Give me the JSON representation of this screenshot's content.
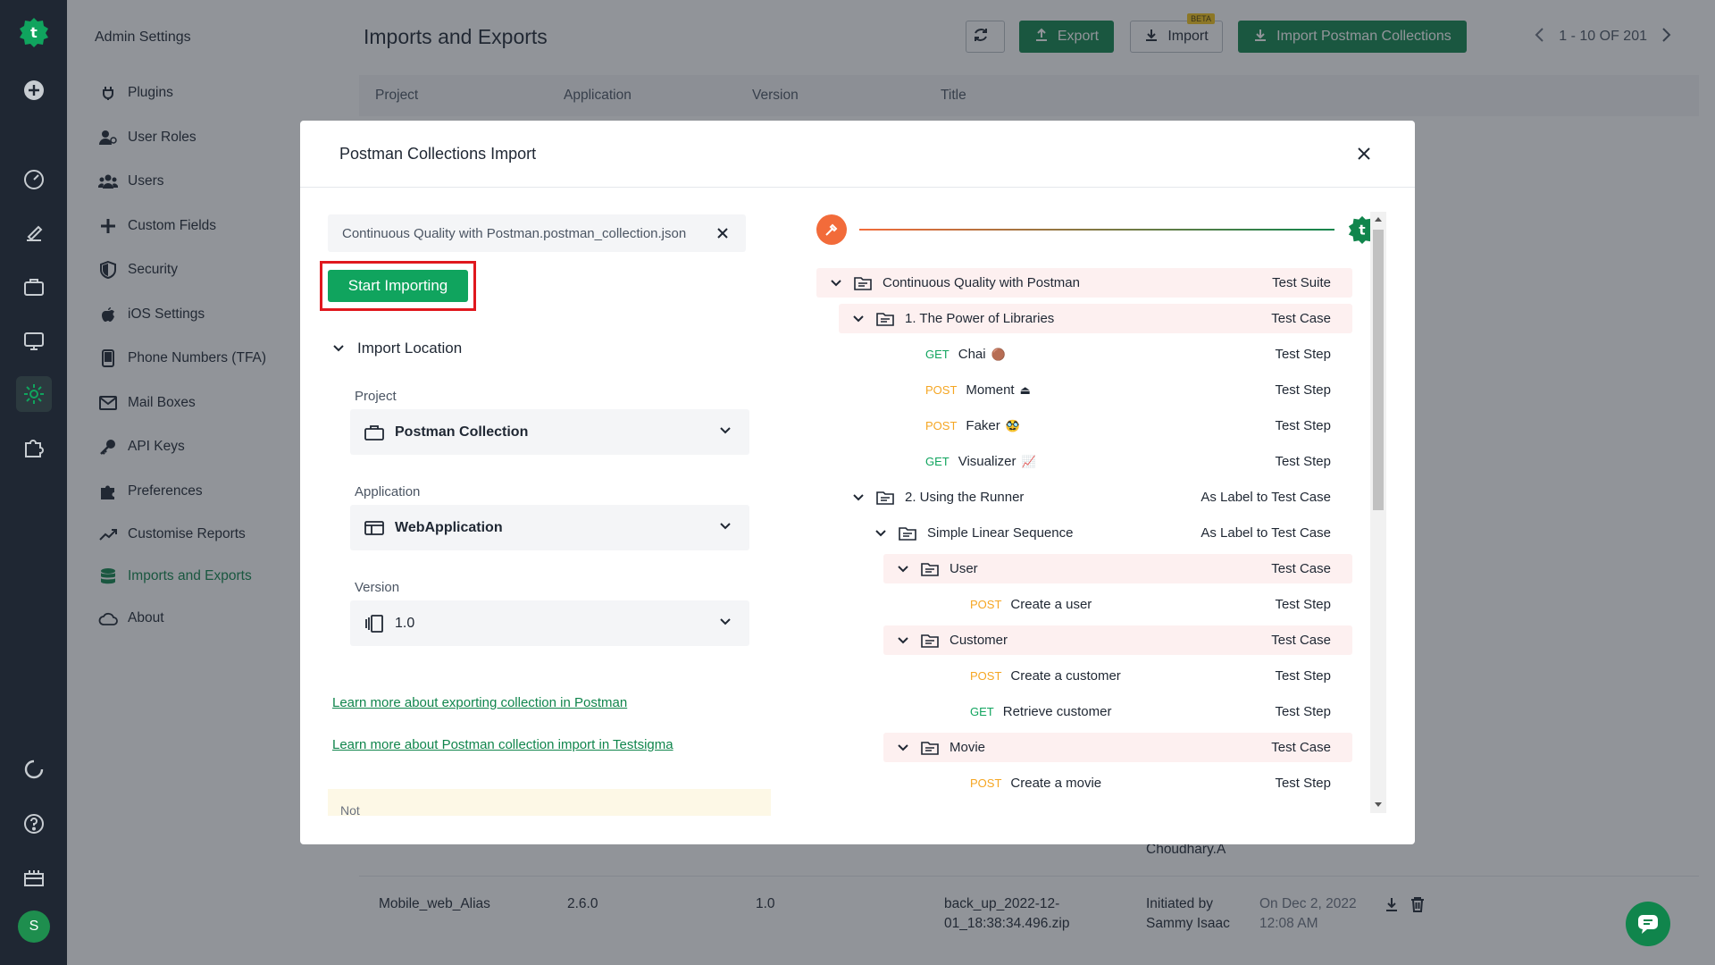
{
  "sidebar": {
    "title": "Admin Settings",
    "items": [
      {
        "label": "Plugins",
        "icon": "plug-icon"
      },
      {
        "label": "User Roles",
        "icon": "user-roles-icon"
      },
      {
        "label": "Users",
        "icon": "users-icon"
      },
      {
        "label": "Custom Fields",
        "icon": "plus-icon"
      },
      {
        "label": "Security",
        "icon": "shield-icon"
      },
      {
        "label": "iOS Settings",
        "icon": "apple-icon"
      },
      {
        "label": "Phone Numbers (TFA)",
        "icon": "phone-icon"
      },
      {
        "label": "Mail Boxes",
        "icon": "mail-icon"
      },
      {
        "label": "API Keys",
        "icon": "key-icon"
      },
      {
        "label": "Preferences",
        "icon": "puzzle-icon"
      },
      {
        "label": "Customise Reports",
        "icon": "chart-line-icon"
      },
      {
        "label": "Imports and Exports",
        "icon": "database-icon",
        "active": true
      },
      {
        "label": "About",
        "icon": "cloud-icon"
      }
    ]
  },
  "rail": {
    "avatar_letter": "S"
  },
  "header": {
    "title": "Imports and Exports",
    "export_label": "Export",
    "import_label": "Import",
    "beta_badge": "BETA",
    "import_postman_label": "Import Postman Collections",
    "pager_text": "1 - 10  OF 201"
  },
  "table": {
    "columns": [
      "Project",
      "Application",
      "Version",
      "Title"
    ],
    "visible_row": {
      "project": "Mobile_web_Alias",
      "application": "2.6.0",
      "version": "1.0",
      "title_line1": "back_up_2022-12-",
      "title_line2": "01_18:38:34.496.zip",
      "initiated_line1": "Initiated by",
      "initiated_line2": "Sammy Isaac",
      "date_line1": "On Dec 2, 2022",
      "date_line2": "12:08 AM"
    },
    "partial_text": "Choudhary.A"
  },
  "modal": {
    "title": "Postman Collections Import",
    "file_name": "Continuous Quality with Postman.postman_collection.json",
    "start_button": "Start Importing",
    "location_title": "Import Location",
    "project_label": "Project",
    "project_value": "Postman Collection",
    "application_label": "Application",
    "application_value": "WebApplication",
    "version_label": "Version",
    "version_value": "1.0",
    "link1": "Learn more about exporting collection in Postman",
    "link2": "Learn more about Postman collection import in Testsigma",
    "note_partial": "Not"
  },
  "tree": [
    {
      "label": "Continuous Quality with Postman",
      "tag": "Test Suite",
      "level": 0,
      "type": "folder",
      "pink": true
    },
    {
      "label": "1. The Power of Libraries",
      "tag": "Test Case",
      "level": 1,
      "type": "folder",
      "pink": true
    },
    {
      "label": "Chai",
      "emoji": "🟤",
      "method": "GET",
      "tag": "Test Step",
      "level": 2,
      "type": "request"
    },
    {
      "label": "Moment",
      "emoji": "⏏",
      "method": "POST",
      "tag": "Test Step",
      "level": 2,
      "type": "request"
    },
    {
      "label": "Faker",
      "emoji": "🥸",
      "method": "POST",
      "tag": "Test Step",
      "level": 2,
      "type": "request"
    },
    {
      "label": "Visualizer",
      "emoji": "📈",
      "method": "GET",
      "tag": "Test Step",
      "level": 2,
      "type": "request"
    },
    {
      "label": "2. Using the Runner",
      "tag": "As Label to Test Case",
      "level": 1,
      "type": "folder",
      "pink": false
    },
    {
      "label": "Simple Linear Sequence",
      "tag": "As Label to Test Case",
      "level": 2,
      "type": "folder",
      "pink": false
    },
    {
      "label": "User",
      "tag": "Test Case",
      "level": 3,
      "type": "folder",
      "pink": true
    },
    {
      "label": "Create a user",
      "method": "POST",
      "tag": "Test Step",
      "level": 4,
      "type": "request"
    },
    {
      "label": "Customer",
      "tag": "Test Case",
      "level": 3,
      "type": "folder",
      "pink": true
    },
    {
      "label": "Create a customer",
      "method": "POST",
      "tag": "Test Step",
      "level": 4,
      "type": "request"
    },
    {
      "label": "Retrieve customer",
      "method": "GET",
      "tag": "Test Step",
      "level": 4,
      "type": "request"
    },
    {
      "label": "Movie",
      "tag": "Test Case",
      "level": 3,
      "type": "folder",
      "pink": true
    },
    {
      "label": "Create a movie",
      "method": "POST",
      "tag": "Test Step",
      "level": 4,
      "type": "request"
    }
  ],
  "colors": {
    "brand": "#10854c",
    "start": "#10a45e",
    "highlight": "#e0181e",
    "postman": "#f26b3a"
  }
}
